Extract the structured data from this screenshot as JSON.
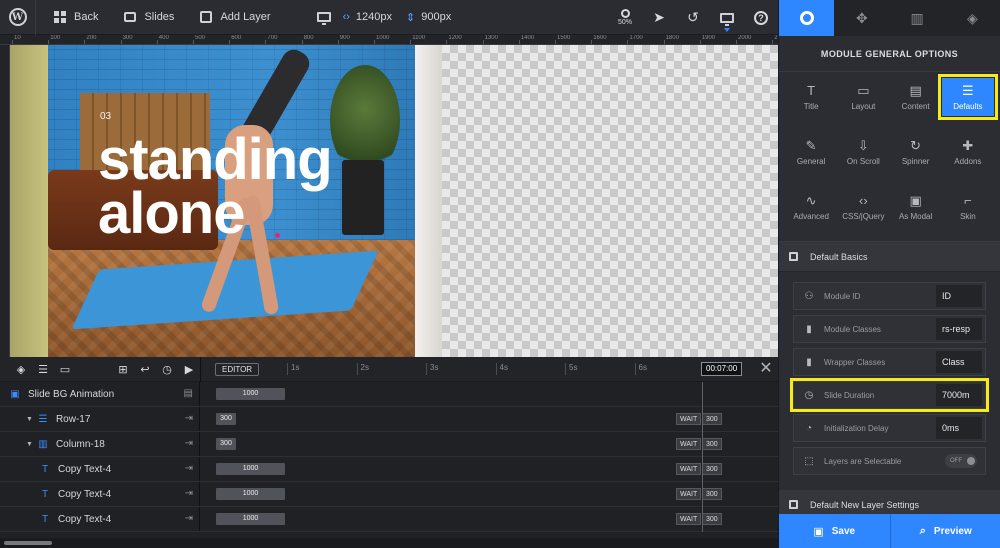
{
  "toolbar": {
    "back_label": "Back",
    "slides_label": "Slides",
    "add_layer_label": "Add Layer",
    "width_value": "1240px",
    "height_value": "900px",
    "zoom_value": "50%"
  },
  "ruler": {
    "marks": [
      "10",
      "100",
      "200",
      "300",
      "400",
      "500",
      "600",
      "700",
      "800",
      "900",
      "1000",
      "1100",
      "1200",
      "1300",
      "1400",
      "1500",
      "1600",
      "1700",
      "1800",
      "1900",
      "2000",
      "2100"
    ]
  },
  "slide": {
    "number": "03",
    "headline_line1": "standing",
    "headline_line2": "alone"
  },
  "timeline": {
    "editor_label": "EDITOR",
    "time_display": "00:07:00",
    "seconds": [
      "1s",
      "2s",
      "3s",
      "4s",
      "5s",
      "6s"
    ],
    "rows": [
      {
        "label": "Slide BG Animation",
        "bar": "1000",
        "wait": null
      },
      {
        "label": "Row-17",
        "bar": "300",
        "wait": "WAIT",
        "wait_value": "300"
      },
      {
        "label": "Column-18",
        "bar": "300",
        "wait": "WAIT",
        "wait_value": "300"
      },
      {
        "label": "Copy Text-4",
        "bar": "1000",
        "wait": "WAIT",
        "wait_value": "300"
      },
      {
        "label": "Copy Text-4",
        "bar": "1000",
        "wait": "WAIT",
        "wait_value": "300"
      },
      {
        "label": "Copy Text-4",
        "bar": "1000",
        "wait": "WAIT",
        "wait_value": "300"
      }
    ]
  },
  "panel": {
    "title": "MODULE GENERAL OPTIONS",
    "options": [
      {
        "label": "Title",
        "icon": "T"
      },
      {
        "label": "Layout",
        "icon": "▭"
      },
      {
        "label": "Content",
        "icon": "▤"
      },
      {
        "label": "Defaults",
        "icon": "☰"
      },
      {
        "label": "General",
        "icon": "✎"
      },
      {
        "label": "On Scroll",
        "icon": "⇩"
      },
      {
        "label": "Spinner",
        "icon": "↻"
      },
      {
        "label": "Addons",
        "icon": "✚"
      },
      {
        "label": "Advanced",
        "icon": "∿"
      },
      {
        "label": "CSS/jQuery",
        "icon": "‹›"
      },
      {
        "label": "As Modal",
        "icon": "▣"
      },
      {
        "label": "Skin",
        "icon": "⌐"
      }
    ],
    "section_basics": "Default Basics",
    "fields": [
      {
        "label": "Module ID",
        "value": "ID",
        "icon": "⚇"
      },
      {
        "label": "Module Classes",
        "value": "rs-resp",
        "icon": "▮"
      },
      {
        "label": "Wrapper Classes",
        "value": "Class",
        "icon": "▮"
      },
      {
        "label": "Slide Duration",
        "value": "7000m",
        "icon": "◷"
      },
      {
        "label": "Initialization Delay",
        "value": "0ms",
        "icon": "◔"
      },
      {
        "label": "Layers are Selectable",
        "value": "OFF",
        "icon": "⬚"
      }
    ],
    "section_new_layer": "Default New Layer Settings",
    "save_label": "Save",
    "preview_label": "Preview"
  },
  "colors": {
    "accent": "#2f87ff",
    "highlight": "#f5ea1a"
  }
}
